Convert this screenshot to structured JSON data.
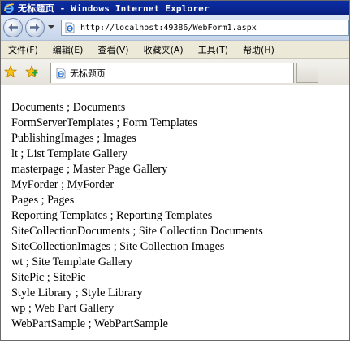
{
  "window": {
    "title": "无标题页 - Windows Internet Explorer"
  },
  "address_bar": {
    "url": "http://localhost:49386/WebForm1.aspx"
  },
  "menu": {
    "items": [
      {
        "label": "文件(F)"
      },
      {
        "label": "编辑(E)"
      },
      {
        "label": "查看(V)"
      },
      {
        "label": "收藏夹(A)"
      },
      {
        "label": "工具(T)"
      },
      {
        "label": "帮助(H)"
      }
    ]
  },
  "tab": {
    "label": "无标题页"
  },
  "content": {
    "lines": [
      "Documents ; Documents",
      "FormServerTemplates ; Form Templates",
      "PublishingImages ; Images",
      "lt ; List Template Gallery",
      "masterpage ; Master Page Gallery",
      "MyForder ; MyForder",
      "Pages ; Pages",
      "Reporting Templates ; Reporting Templates",
      "SiteCollectionDocuments ; Site Collection Documents",
      "SiteCollectionImages ; Site Collection Images",
      "wt ; Site Template Gallery",
      "SitePic ; SitePic",
      "Style Library ; Style Library",
      "wp ; Web Part Gallery",
      "WebPartSample ; WebPartSample"
    ]
  },
  "icons": {
    "title": "ie-logo-icon",
    "back": "back-arrow-icon",
    "forward": "forward-arrow-icon",
    "history": "chevron-down-icon",
    "page": "ie-page-icon",
    "favorites": "favorites-star-icon",
    "add_favorite": "add-favorite-icon",
    "tab": "ie-page-icon"
  },
  "colors": {
    "titlebar": "#0a2692",
    "menubar": "#ece9d8",
    "ie_blue": "#1e6fd0"
  }
}
